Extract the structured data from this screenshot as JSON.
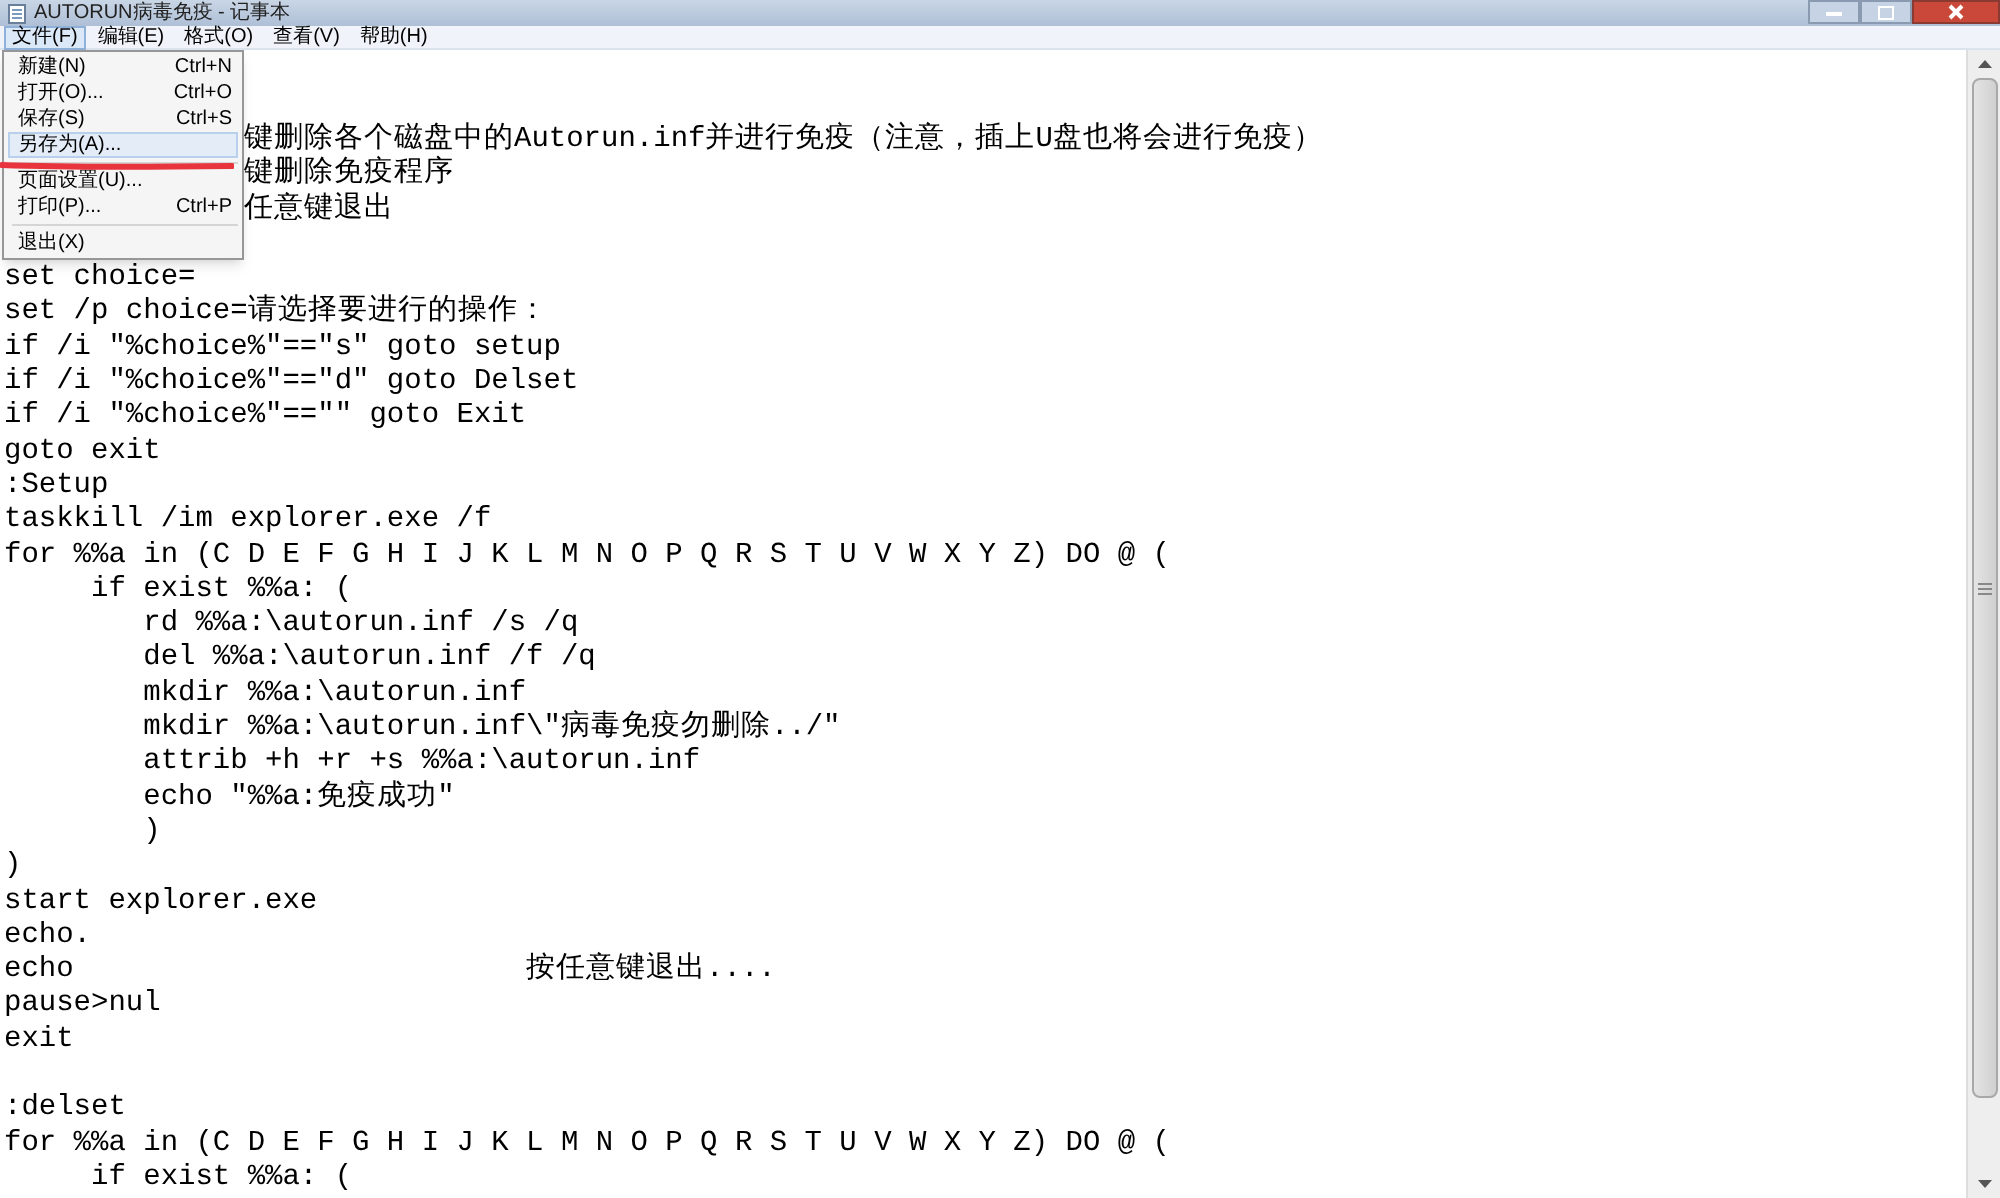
{
  "window": {
    "title": "AUTORUN病毒免疫 - 记事本"
  },
  "menu_bar": [
    {
      "label": "文件(F)",
      "selected": true
    },
    {
      "label": "编辑(E)",
      "selected": false
    },
    {
      "label": "格式(O)",
      "selected": false
    },
    {
      "label": "查看(V)",
      "selected": false
    },
    {
      "label": "帮助(H)",
      "selected": false
    }
  ],
  "file_menu": [
    {
      "kind": "item",
      "label": "新建(N)",
      "shortcut": "Ctrl+N",
      "selected": false
    },
    {
      "kind": "item",
      "label": "打开(O)...",
      "shortcut": "Ctrl+O",
      "selected": false
    },
    {
      "kind": "item",
      "label": "保存(S)",
      "shortcut": "Ctrl+S",
      "selected": false
    },
    {
      "kind": "item",
      "label": "另存为(A)...",
      "selected": true
    },
    {
      "kind": "separator"
    },
    {
      "kind": "item",
      "label": "页面设置(U)...",
      "selected": false
    },
    {
      "kind": "item",
      "label": "打印(P)...",
      "shortcut": "Ctrl+P",
      "selected": false
    },
    {
      "kind": "separator"
    },
    {
      "kind": "item",
      "label": "退出(X)",
      "selected": false
    }
  ],
  "editor_lines": [
    {
      "text": "键删除各个磁盘中的Autorun.inf并进行免疫（注意，插上U盘也将会进行免疫）",
      "covered": true
    },
    {
      "text": "键删除免疫程序",
      "covered": true
    },
    {
      "text": "任意键退出",
      "covered": true
    },
    {
      "text": "set choice=",
      "gap_before": true
    },
    {
      "text": "set /p choice=请选择要进行的操作："
    },
    {
      "text": "if /i \"%choice%\"==\"s\" goto setup"
    },
    {
      "text": "if /i \"%choice%\"==\"d\" goto Delset"
    },
    {
      "text": "if /i \"%choice%\"==\"\" goto Exit"
    },
    {
      "text": "goto exit"
    },
    {
      "text": ":Setup"
    },
    {
      "text": "taskkill /im explorer.exe /f"
    },
    {
      "text": "for %%a in (C D E F G H I J K L M N O P Q R S T U V W X Y Z) DO @ ("
    },
    {
      "text": "     if exist %%a: ("
    },
    {
      "text": "        rd %%a:\\autorun.inf /s /q"
    },
    {
      "text": "        del %%a:\\autorun.inf /f /q"
    },
    {
      "text": "        mkdir %%a:\\autorun.inf"
    },
    {
      "text": "        mkdir %%a:\\autorun.inf\\\"病毒免疫勿删除../\""
    },
    {
      "text": "        attrib +h +r +s %%a:\\autorun.inf"
    },
    {
      "text": "        echo \"%%a:免疫成功\""
    },
    {
      "text": "        )"
    },
    {
      "text": ")"
    },
    {
      "text": "start explorer.exe"
    },
    {
      "text": "echo."
    },
    {
      "text": "echo                          按任意键退出...."
    },
    {
      "text": "pause>nul"
    },
    {
      "text": "exit"
    },
    {
      "text": ":delset",
      "gap_before": true
    },
    {
      "text": "for %%a in (C D E F G H I J K L M N O P Q R S T U V W X Y Z) DO @ ("
    },
    {
      "text": "     if exist %%a: ("
    }
  ]
}
